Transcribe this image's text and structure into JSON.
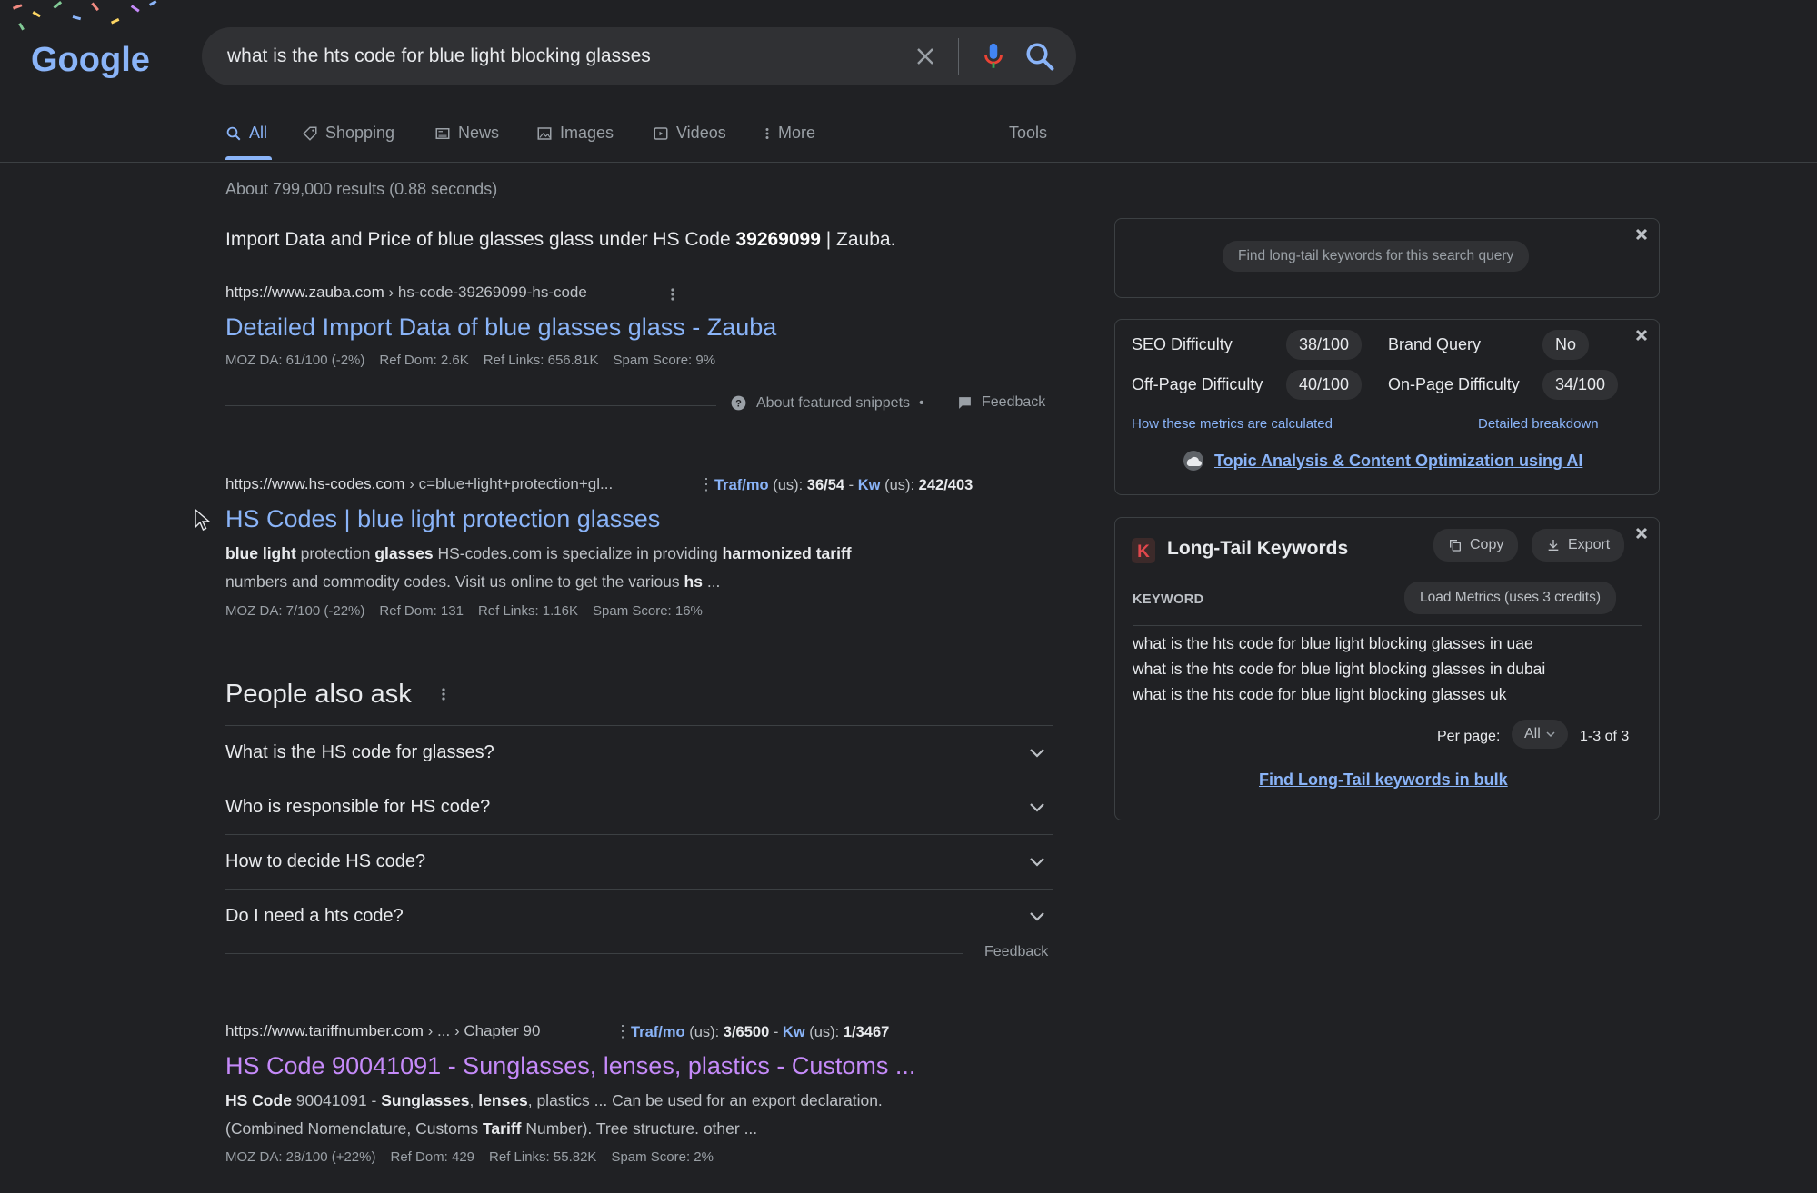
{
  "header": {
    "logo_text": "Google",
    "search_query": "what is the hts code for blue light blocking glasses",
    "tabs": [
      {
        "label": "All",
        "icon": "search-icon",
        "active": true
      },
      {
        "label": "Shopping",
        "icon": "tag-icon"
      },
      {
        "label": "News",
        "icon": "newspaper-icon"
      },
      {
        "label": "Images",
        "icon": "image-icon"
      },
      {
        "label": "Videos",
        "icon": "play-icon"
      },
      {
        "label": "More",
        "icon": "more-vert-icon"
      }
    ],
    "tools_label": "Tools"
  },
  "results_stats": "About 799,000 results (0.88 seconds)",
  "featured_snippet": {
    "title_prefix": "Import Data and Price of blue glasses glass under HS Code ",
    "title_bold": "39269099",
    "title_suffix": " | Zauba.",
    "url_domain": "https://www.zauba.com",
    "url_path": " › hs-code-39269099-hs-code",
    "link_title": "Detailed Import Data of blue glasses glass - Zauba",
    "metrics": [
      "MOZ DA: 61/100 (-2%)",
      "Ref Dom: 2.6K",
      "Ref Links: 656.81K",
      "Spam Score: 9%"
    ],
    "about_label": "About featured snippets",
    "bullet": "•",
    "feedback_label": "Feedback"
  },
  "result2": {
    "url_domain": "https://www.hs-codes.com",
    "url_path": " › c=blue+light+protection+gl...",
    "traf_label": "Traf/mo",
    "traf_us": " (us): ",
    "traf_value": "36/54",
    "sep": " - ",
    "kw_label": "Kw",
    "kw_us": " (us): ",
    "kw_value": "242/403",
    "title": "HS Codes | blue light protection glasses",
    "desc_line1": [
      "blue light",
      " protection ",
      "glasses",
      " HS-codes.com is specialize in providing ",
      "harmonized tariff"
    ],
    "desc_line2": [
      "numbers and commodity codes. Visit us online to get the various ",
      "hs",
      " ..."
    ],
    "metrics": [
      "MOZ DA: 7/100 (-22%)",
      "Ref Dom: 131",
      "Ref Links: 1.16K",
      "Spam Score: 16%"
    ]
  },
  "people_also_ask": {
    "heading": "People also ask",
    "questions": [
      "What is the HS code for glasses?",
      "Who is responsible for HS code?",
      "How to decide HS code?",
      "Do I need a hts code?"
    ],
    "feedback_label": "Feedback"
  },
  "result3": {
    "url_domain": "https://www.tariffnumber.com",
    "url_path": " › ... › Chapter 90",
    "traf_label": "Traf/mo",
    "traf_us": " (us): ",
    "traf_value": "3/6500",
    "sep": " - ",
    "kw_label": "Kw",
    "kw_us": " (us): ",
    "kw_value": "1/3467",
    "title": "HS Code 90041091 - Sunglasses, lenses, plastics - Customs ...",
    "desc_line1": [
      "HS Code",
      " 90041091 - ",
      "Sunglasses",
      ", ",
      "lenses",
      ", plastics ... Can be used for an export declaration."
    ],
    "desc_line2": [
      "(Combined Nomenclature, Customs ",
      "Tariff",
      " Number). Tree structure. other ..."
    ],
    "metrics": [
      "MOZ DA: 28/100 (+22%)",
      "Ref Dom: 429",
      "Ref Links: 55.82K",
      "Spam Score: 2%"
    ]
  },
  "side_panel": {
    "find_longtail_label": "Find long-tail keywords for this search query",
    "seo_difficulty_label": "SEO Difficulty",
    "seo_difficulty_value": "38/100",
    "brand_query_label": "Brand Query",
    "brand_query_value": "No",
    "offpage_label": "Off-Page Difficulty",
    "offpage_value": "40/100",
    "onpage_label": "On-Page Difficulty",
    "onpage_value": "34/100",
    "how_calculated_link": "How these metrics are calculated",
    "breakdown_link": "Detailed breakdown",
    "topic_link": "Topic Analysis & Content Optimization using AI",
    "longtail": {
      "logo_letter": "K",
      "title": "Long-Tail Keywords",
      "copy_label": "Copy",
      "export_label": "Export",
      "keyword_header": "KEYWORD",
      "load_metrics_label": "Load Metrics (uses 3 credits)",
      "keywords": [
        "what is the hts code for blue light blocking glasses in uae",
        "what is the hts code for blue light blocking glasses in dubai",
        "what is the hts code for blue light blocking glasses uk"
      ],
      "per_page_label": "Per page:",
      "per_page_value": "All",
      "range_label": "1-3 of 3",
      "bulk_link": "Find Long-Tail keywords in bulk"
    }
  },
  "colors": {
    "background": "#202124",
    "link": "#8ab4f8",
    "visited_link": "#c58af9",
    "text": "#e8eaed",
    "muted": "#9aa0a6"
  }
}
